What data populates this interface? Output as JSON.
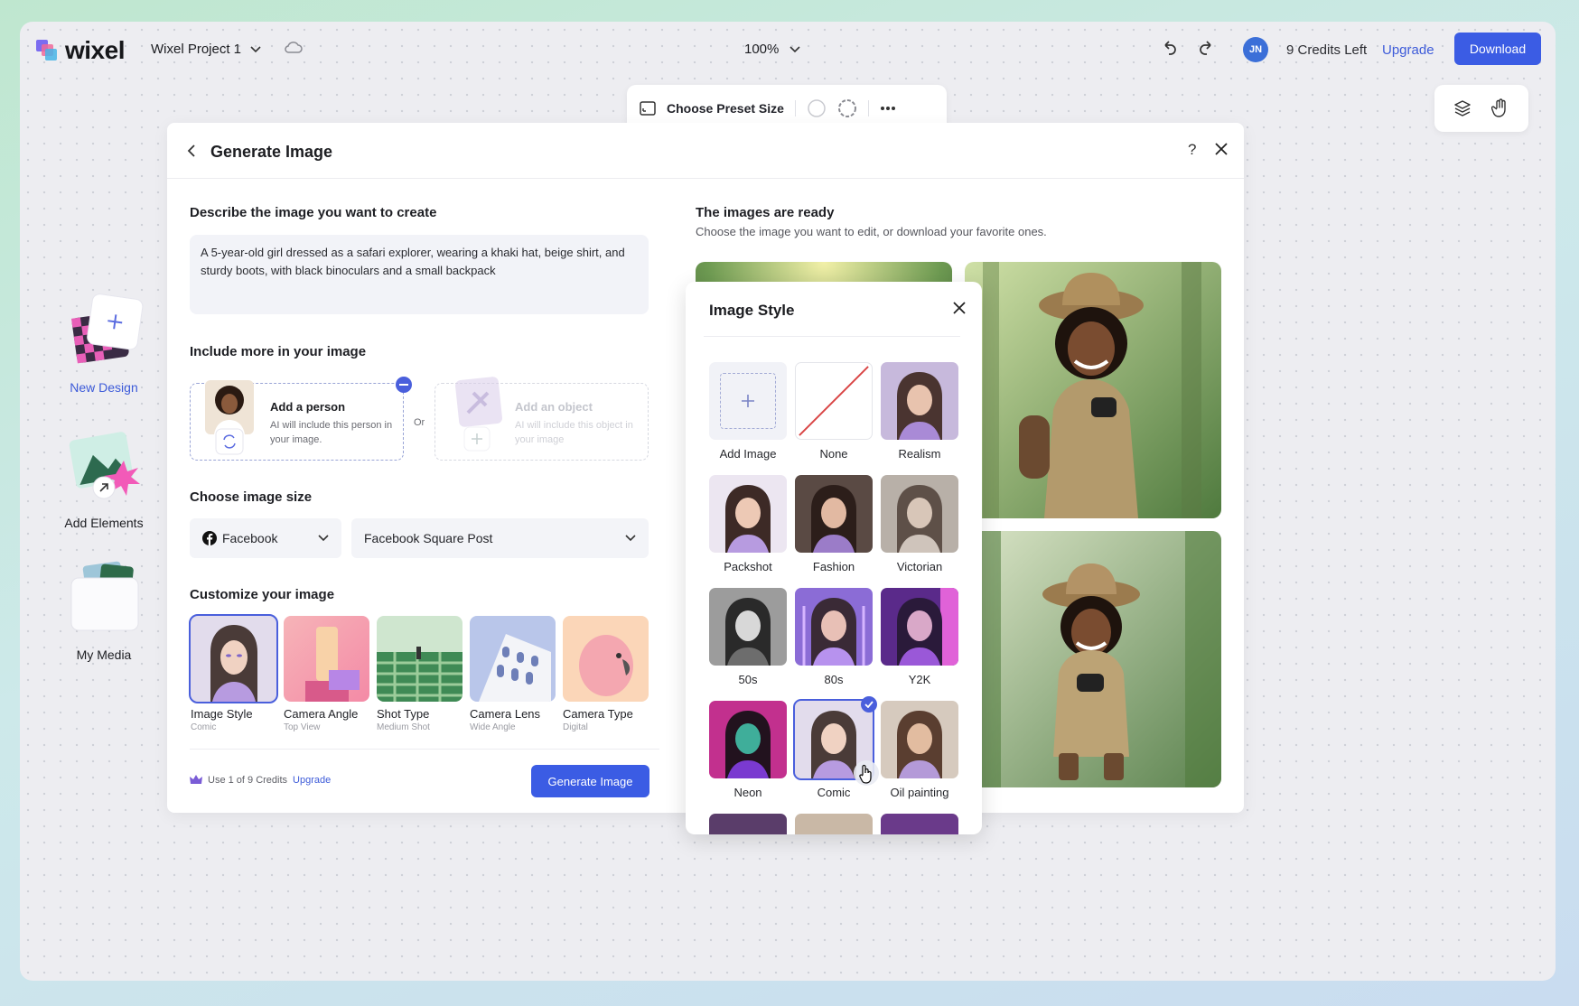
{
  "app": {
    "logo": "wixel",
    "project_name": "Wixel Project 1",
    "zoom": "100%",
    "avatar_initials": "JN",
    "credits_left": "9 Credits Left",
    "upgrade": "Upgrade",
    "download": "Download"
  },
  "toolbar": {
    "preset_label": "Choose Preset Size"
  },
  "sidebar": {
    "items": [
      {
        "label": "New Design"
      },
      {
        "label": "Add Elements"
      },
      {
        "label": "My Media"
      }
    ]
  },
  "panel": {
    "title": "Generate Image",
    "help": "?",
    "describe": {
      "title": "Describe the image you want to create",
      "prompt": "A 5-year-old girl dressed as a safari explorer, wearing a khaki hat, beige shirt, and sturdy boots, with black binoculars and a small backpack"
    },
    "include": {
      "title": "Include more in your image",
      "person": {
        "title": "Add a person",
        "desc": "AI will include this person in your image."
      },
      "or": "Or",
      "object": {
        "title": "Add an object",
        "desc": "AI will include this object in your image"
      }
    },
    "size": {
      "title": "Choose image size",
      "platform": "Facebook",
      "format": "Facebook Square Post"
    },
    "customize": {
      "title": "Customize your image",
      "tiles": [
        {
          "name": "Image Style",
          "value": "Comic"
        },
        {
          "name": "Camera Angle",
          "value": "Top View"
        },
        {
          "name": "Shot Type",
          "value": "Medium Shot"
        },
        {
          "name": "Camera Lens",
          "value": "Wide Angle"
        },
        {
          "name": "Camera Type",
          "value": "Digital"
        }
      ]
    },
    "footer": {
      "credits_note": "Use 1 of 9 Credits",
      "upgrade": "Upgrade",
      "generate": "Generate Image"
    },
    "results": {
      "title": "The images are ready",
      "subtitle": "Choose the image you want to edit, or download your favorite ones."
    }
  },
  "image_style": {
    "title": "Image Style",
    "options": [
      {
        "name": "Add Image"
      },
      {
        "name": "None"
      },
      {
        "name": "Realism"
      },
      {
        "name": "Packshot"
      },
      {
        "name": "Fashion"
      },
      {
        "name": "Victorian"
      },
      {
        "name": "50s"
      },
      {
        "name": "80s"
      },
      {
        "name": "Y2K"
      },
      {
        "name": "Neon"
      },
      {
        "name": "Comic",
        "selected": true
      },
      {
        "name": "Oil painting"
      }
    ]
  },
  "colors": {
    "accent": "#3b5ce4",
    "selection": "#4a5fdc",
    "canvas": "#ededf1"
  }
}
